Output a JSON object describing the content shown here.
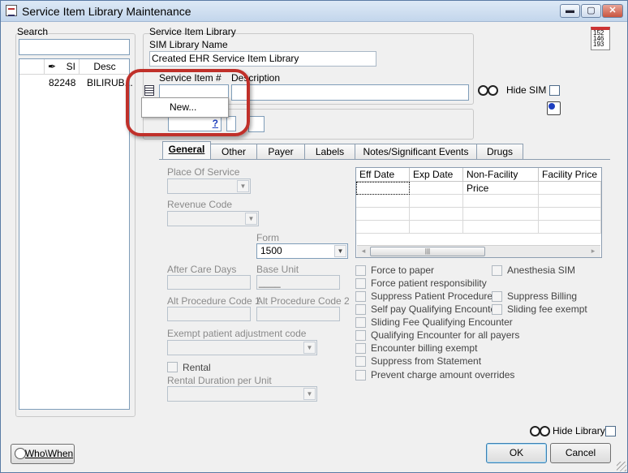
{
  "window": {
    "title": "Service Item Library Maintenance",
    "min_glyph": "▬",
    "max_glyph": "▢",
    "close_glyph": "✕"
  },
  "calendar_icon": {
    "lines": [
      "152",
      "146",
      "193"
    ]
  },
  "search": {
    "label": "Search",
    "value": "",
    "columns": {
      "si": "SI",
      "desc": "Desc"
    },
    "rows": [
      {
        "si": "82248",
        "desc": "BILIRUB..."
      }
    ]
  },
  "library": {
    "group_label": "Service Item Library",
    "name_label": "SIM Library Name",
    "name_value": "Created EHR Service Item Library"
  },
  "item": {
    "service_item_label": "Service Item #",
    "description_label": "Description",
    "service_item_value": "",
    "description_value": "",
    "hide_sim_label": "Hide SIM",
    "lookup_button": "?"
  },
  "context_menu": {
    "new_label": "New..."
  },
  "tabs": [
    {
      "label": "General",
      "active": true
    },
    {
      "label": "Other"
    },
    {
      "label": "Payer"
    },
    {
      "label": "Labels"
    },
    {
      "label": "Notes/Significant Events"
    },
    {
      "label": "Drugs"
    }
  ],
  "general": {
    "place_of_service_label": "Place Of Service",
    "revenue_code_label": "Revenue Code",
    "form_label": "Form",
    "form_value": "1500",
    "after_care_days_label": "After Care Days",
    "base_unit_label": "Base Unit",
    "base_unit_value": "____",
    "alt_code1_label": "Alt Procedure Code 1",
    "alt_code2_label": "Alt Procedure Code 2",
    "exempt_label": "Exempt patient adjustment code",
    "rental_label": "Rental",
    "rental_duration_label": "Rental Duration per Unit"
  },
  "fee_grid": {
    "columns": [
      "Eff Date",
      "Exp Date",
      "Non-Facility Price",
      "Facility Price"
    ],
    "scroll_left": "◂",
    "scroll_thumb": "|||",
    "scroll_right": "▸"
  },
  "checkboxes_left": [
    "Force to paper",
    "Force patient responsibility",
    "Suppress Patient Procedure",
    "Self pay Qualifying Encounter",
    "Sliding Fee Qualifying Encounter",
    "Qualifying Encounter for all payers",
    "Encounter billing exempt",
    "Suppress from Statement",
    "Prevent charge amount overrides"
  ],
  "checkboxes_right": [
    "Anesthesia SIM",
    "Suppress Billing",
    "Sliding fee exempt"
  ],
  "footer": {
    "hide_library_label": "Hide Library",
    "who_when_label": "Who\\When",
    "ok_label": "OK",
    "cancel_label": "Cancel"
  },
  "colors": {
    "highlight": "#c0302a",
    "link_blue": "#1e3fbf"
  }
}
